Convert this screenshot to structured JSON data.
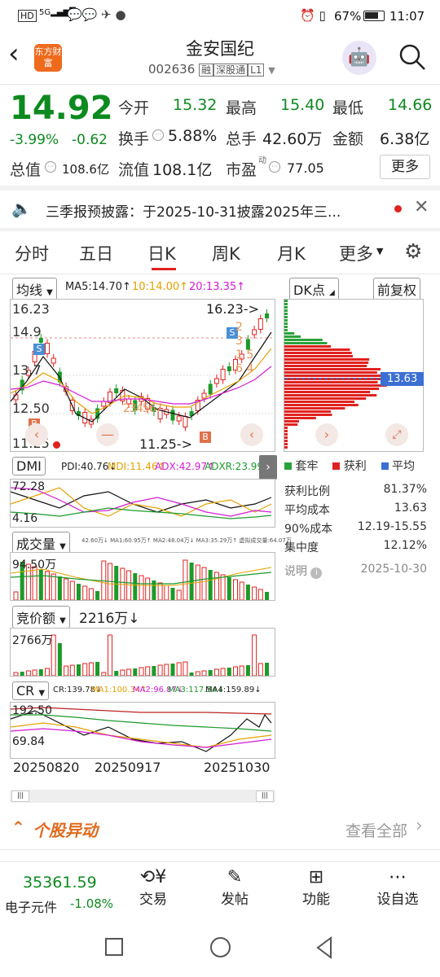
{
  "status": {
    "left_icons": "HD 5G",
    "time": "11:07",
    "battery": "67%"
  },
  "header": {
    "title": "金安国纪",
    "code": "002636",
    "badges": [
      "融",
      "深股通",
      "L1"
    ],
    "logo_text": "东方财富"
  },
  "quote": {
    "price": "14.92",
    "change_pct": "-3.99%",
    "change_abs": "-0.62",
    "open_label": "今开",
    "open": "15.32",
    "high_label": "最高",
    "high": "15.40",
    "low_label": "最低",
    "low": "14.66",
    "turnover_label": "换手",
    "turnover": "5.88%",
    "volume_label": "总手",
    "volume": "42.60万",
    "amount_label": "金额",
    "amount": "6.38亿",
    "mktcap_label": "总值",
    "mktcap": "108.6亿",
    "float_label": "流值",
    "float": "108.1亿",
    "pe_label": "市盈",
    "pe_sup": "动",
    "pe": "77.05",
    "more_btn": "更多"
  },
  "notice": {
    "text": "三季报预披露：于2025-10-31披露2025年三..."
  },
  "tabs": [
    "分时",
    "五日",
    "日K",
    "周K",
    "月K",
    "更多"
  ],
  "active_tab": "日K",
  "kline": {
    "ma_selector": "均线",
    "ma5": "MA5:14.70↑",
    "ma10": "10:14.00↑",
    "ma20": "20:13.35↑",
    "y_labels": [
      "16.23",
      "14.9",
      "13.7",
      "12.50",
      "11.25"
    ],
    "high_marker": "16.23->",
    "low_marker": "11.25->",
    "nine_turn_down": [
      "2",
      "3",
      "4",
      "5",
      "6",
      "7"
    ],
    "nine_turn_up": [
      "1",
      "2",
      "3",
      "4",
      "5",
      "6"
    ]
  },
  "chip": {
    "selector": "DK点",
    "adjust": "前复权",
    "avg_cost_tag": "13.63",
    "legend": [
      "套牢",
      "获利",
      "平均"
    ],
    "stats": [
      {
        "label": "获利比例",
        "value": "81.37%"
      },
      {
        "label": "平均成本",
        "value": "13.63"
      },
      {
        "label": "90%成本",
        "value": "12.19-15.55"
      },
      {
        "label": "集中度",
        "value": "12.12%"
      }
    ],
    "note_label": "说明",
    "note_date": "2025-10-30"
  },
  "dmi": {
    "name": "DMI",
    "pdi": "PDI:40.76↓",
    "mdi": "MDI:11.46↑",
    "adx": "ADX:42.97↑",
    "adxr": "ADXR:23.99↑",
    "y_top": "72.28",
    "y_bot": "4.16"
  },
  "vol": {
    "name": "成交量",
    "values": "42.60万↓ MA1:60.95万↑ MA2:48.04万↓ MA3:35.29万↑ 虚拟成交量:64.07万",
    "y_top": "94.50万"
  },
  "auction": {
    "name": "竞价额",
    "value": "2216万↓",
    "y_top": "2766万"
  },
  "cr": {
    "name": "CR",
    "cr": "CR:139.78↓",
    "ma1": "MA1:100.34↑",
    "ma2": "MA2:96.87↓",
    "ma3": "MA3:117.54↓",
    "ma4": "MA4:159.89↓",
    "y_top": "192.50",
    "y_bot": "69.84"
  },
  "dates": [
    "20250820",
    "20250917",
    "20251030"
  ],
  "news": {
    "title": "个股异动",
    "link": "查看全部"
  },
  "bottom": {
    "index_value": "35361.59",
    "index_name": "电子元件",
    "index_pct": "-1.08%",
    "items": [
      "交易",
      "发帖",
      "功能",
      "设自选"
    ]
  }
}
